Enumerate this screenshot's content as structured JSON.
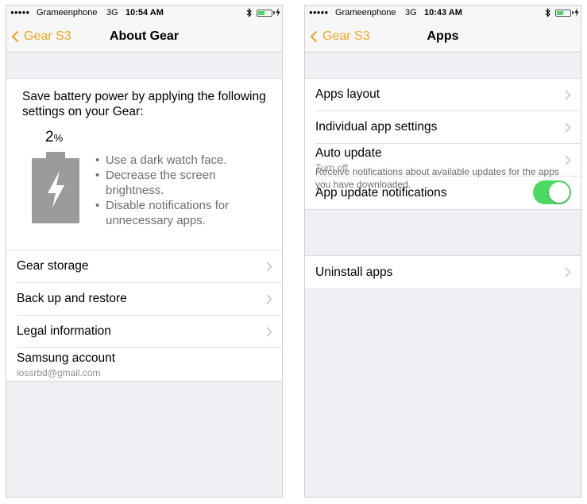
{
  "left": {
    "status": {
      "signal": "●●●●●",
      "carrier": "Grameenphone",
      "network": "3G",
      "time": "10:54 AM"
    },
    "nav": {
      "back_label": "Gear S3",
      "title": "About Gear"
    },
    "battery_card": {
      "title": "Save battery power by applying the following settings on your Gear:",
      "percent": "2",
      "percent_unit": "%",
      "tips": [
        "Use a dark watch face.",
        "Decrease the screen brightness.",
        "Disable notifications for unnecessary apps."
      ]
    },
    "rows": [
      {
        "label": "Gear storage"
      },
      {
        "label": "Back up and restore"
      },
      {
        "label": "Legal information"
      }
    ],
    "account": {
      "label": "Samsung account",
      "email": "iossrbd@gmail.com"
    }
  },
  "right": {
    "status": {
      "signal": "●●●●●",
      "carrier": "Grameenphone",
      "network": "3G",
      "time": "10:43 AM"
    },
    "nav": {
      "back_label": "Gear S3",
      "title": "Apps"
    },
    "rows": [
      {
        "label": "Apps layout"
      },
      {
        "label": "Individual app settings"
      },
      {
        "label": "Auto update",
        "sub": "Turn off"
      },
      {
        "label": "App update notifications"
      }
    ],
    "footer_note": "Receive notifications about available updates for the apps you have downloaded.",
    "uninstall": {
      "label": "Uninstall apps"
    }
  },
  "colors": {
    "accent": "#f5a623",
    "toggle_on": "#4cd964",
    "battery_gray": "#9b9b9b"
  }
}
